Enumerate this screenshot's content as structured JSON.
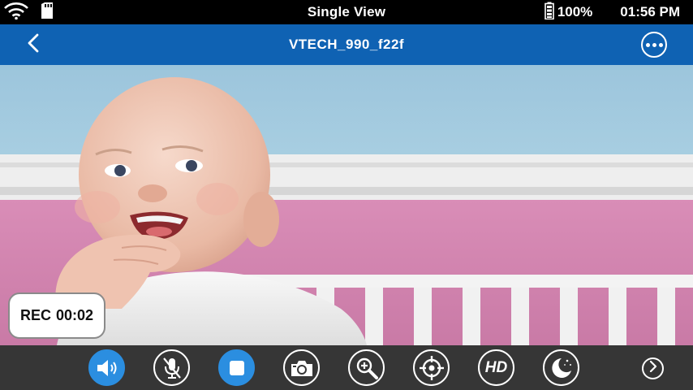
{
  "status_bar": {
    "title": "Single View",
    "battery": "100%",
    "time": "01:56 PM",
    "icons": [
      "wifi-icon",
      "sd-card-icon",
      "battery-icon"
    ]
  },
  "nav_bar": {
    "camera_name": "VTECH_990_f22f",
    "icons": [
      "back-chevron-icon",
      "more-options-icon"
    ],
    "color": "#0f62b3"
  },
  "video": {
    "description_icons": [
      "baby-camera-feed"
    ]
  },
  "recording": {
    "label": "REC",
    "elapsed": "00:02"
  },
  "controls": {
    "background": "#363636",
    "active_color": "#2b8ee0",
    "buttons": [
      {
        "name": "speaker-button",
        "icon": "speaker-icon",
        "active": true
      },
      {
        "name": "microphone-button",
        "icon": "microphone-muted-icon",
        "active": false
      },
      {
        "name": "record-stop-button",
        "icon": "stop-icon",
        "active": true
      },
      {
        "name": "snapshot-button",
        "icon": "camera-icon",
        "active": false
      },
      {
        "name": "zoom-button",
        "icon": "zoom-in-icon",
        "active": false
      },
      {
        "name": "pan-tilt-button",
        "icon": "crosshair-icon",
        "active": false
      },
      {
        "name": "hd-button",
        "icon": "hd-icon",
        "label": "HD",
        "active": false
      },
      {
        "name": "night-mode-button",
        "icon": "moon-icon",
        "active": false
      }
    ],
    "next_icon": "chevron-right-icon"
  }
}
